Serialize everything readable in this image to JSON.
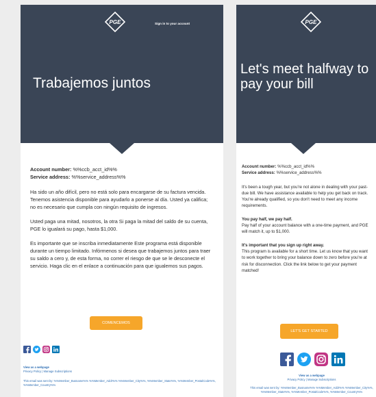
{
  "colors": {
    "hero_bg": "#3a4556",
    "cta_bg": "#f6a62a",
    "link": "#2f6fb4",
    "facebook": "#3b5998",
    "twitter": "#1da1f2",
    "instagram": "#c13584",
    "linkedin": "#0077b5"
  },
  "email_es": {
    "logo_text": "PGE",
    "signin_label": "Sign in to your account",
    "hero_title": "Trabajemos juntos",
    "account_label": "Account number:",
    "account_value": "%%ccb_acct_id%%",
    "service_label": "Service address:",
    "service_value": "%%service_address%%",
    "paragraphs": [
      "Ha sido un año difícil, pero no está solo para encargarse de su factura vencida. Tenemos asistencia disponible para ayudarlo a ponerse al día. Usted ya califica; no es necesario que cumpla con ningún requisito de ingresos.",
      "Usted paga una mitad, nosotros, la otra Si paga la mitad del saldo de su cuenta, PGE lo igualará su pago, hasta $1,000.",
      "Es importante que se inscriba inmediatamente Este programa está disponible durante un tiempo limitado. Infórmenos si desea que trabajemos juntos para traer su saldo a cero y, de esta forma, no correr el riesgo de que se le desconecte el servicio. Haga clic en el enlace a continuación para que igualemos sus pagos."
    ],
    "cta_label": "COMENCEMOS",
    "social_icons": [
      "facebook-icon",
      "twitter-icon",
      "instagram-icon",
      "linkedin-icon"
    ],
    "footer_webpage": "View as a webpage",
    "footer_links": "Privacy Policy | Manage Subscriptions",
    "footer_sent": "This email was sent by: %%Member_Busname%% %%Member_Addr%% %%Member_City%%, %%Member_State%%, %%Member_PostalCode%%, %%Member_Country%%"
  },
  "email_en": {
    "logo_text": "PGE",
    "hero_title": "Let's meet halfway to pay your bill",
    "account_label": "Account number:",
    "account_value": "%%ccb_acct_id%%",
    "service_label": "Service address:",
    "service_value": "%%service_address%%",
    "intro": "It's been a tough year, but you're not alone in dealing with your past-due bill. We have assistance available to help you get back on track. You're already qualified, so you don't need to meet any income requirements.",
    "half_lead": "You pay half, we pay half.",
    "half_text": "Pay half of your account balance with a one-time payment, and PGE will match it, up to $1,000.",
    "now_lead": "It's important that you sign up right away.",
    "now_text": "This program is available for a short time. Let us know that you want to work together to bring your balance down to zero before you're at risk for disconnection. Click the link below to get your payment matched!",
    "cta_label": "LET'S GET STARTED",
    "social_icons": [
      "facebook-icon",
      "twitter-icon",
      "instagram-icon",
      "linkedin-icon"
    ],
    "footer_webpage": "View as a webpage",
    "footer_links": "Privacy Policy | Manage Subscriptions",
    "footer_sent": "This email was sent by: %%Member_Busname%% %%Member_Addr%% %%Member_City%%, %%Member_State%%, %%Member_PostalCode%%, %%Member_Country%%"
  }
}
